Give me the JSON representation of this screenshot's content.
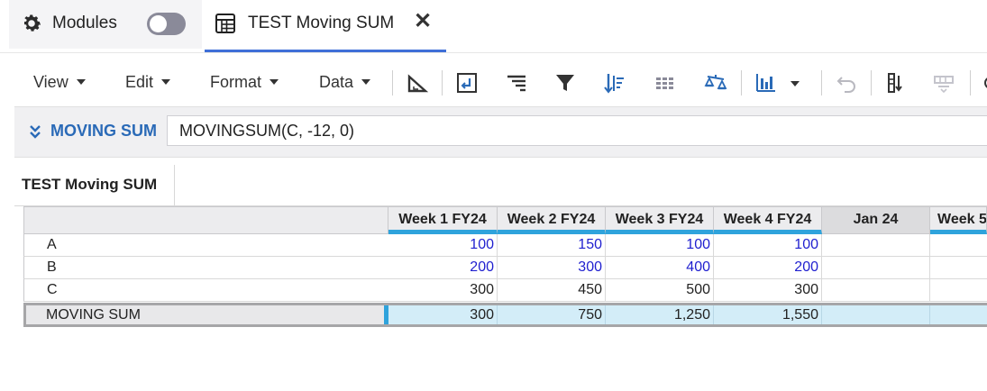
{
  "tabs": {
    "modules_label": "Modules",
    "doc_tab_label": "TEST Moving SUM",
    "close_glyph": "✕"
  },
  "toolbar": {
    "menus": [
      "View",
      "Edit",
      "Format",
      "Data"
    ],
    "icons": [
      "pivot-icon",
      "insert-icon",
      "indent-icon",
      "filter-icon",
      "sort-icon",
      "grid-lines-icon",
      "balance-icon",
      "chart-icon",
      "undo-icon",
      "column-freeze-icon",
      "row-hide-icon"
    ]
  },
  "formula": {
    "line_item": "MOVING SUM",
    "expression": "MOVINGSUM(C, -12, 0)"
  },
  "sheet": {
    "tab_label": "TEST Moving SUM",
    "columns": [
      "Week 1 FY24",
      "Week 2 FY24",
      "Week 3 FY24",
      "Week 4 FY24",
      "Jan 24",
      "Week 5"
    ],
    "rows": [
      {
        "label": "A",
        "values": [
          "100",
          "150",
          "100",
          "100",
          "",
          ""
        ]
      },
      {
        "label": "B",
        "values": [
          "200",
          "300",
          "400",
          "200",
          "",
          ""
        ]
      },
      {
        "label": "C",
        "values": [
          "300",
          "450",
          "500",
          "300",
          "",
          ""
        ]
      },
      {
        "label": "MOVING SUM",
        "values": [
          "300",
          "750",
          "1,250",
          "1,550",
          "",
          ""
        ]
      }
    ]
  },
  "colors": {
    "accent_blue": "#2fa3dc",
    "tab_underline": "#3f6fd8",
    "input_value_blue": "#1f1fcf",
    "formula_name_blue": "#2a6ab7",
    "selected_row_fill": "#d3edf8"
  }
}
